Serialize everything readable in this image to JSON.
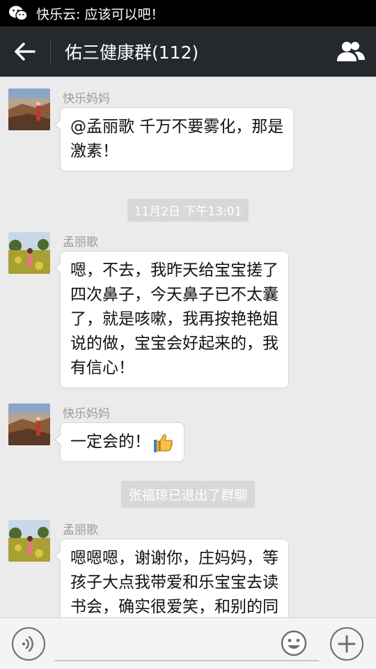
{
  "status_bar": {
    "notification_icon": "wechat-icon",
    "notification_text": "快乐云: 应该可以吧！"
  },
  "title_bar": {
    "back_icon": "arrow-left-icon",
    "title": "佑三健康群(112)",
    "members_icon": "group-members-icon"
  },
  "messages": [
    {
      "type": "msg",
      "sender": "快乐妈妈",
      "avatar": "canyon",
      "lines": [
        "@孟丽歌 千万不要雾化，那是",
        "激素！"
      ]
    },
    {
      "type": "system",
      "text": "11月2日 下午13:01"
    },
    {
      "type": "msg",
      "sender": "孟丽歌",
      "avatar": "field",
      "lines": [
        "嗯，不去，我昨天给宝宝搓了",
        "四次鼻子，今天鼻子已不太囊",
        "了，就是咳嗽，我再按艳艳姐",
        "说的做，宝宝会好起来的，我",
        "有信心！"
      ]
    },
    {
      "type": "msg",
      "sender": "快乐妈妈",
      "avatar": "canyon",
      "lines": [
        "一定会的！"
      ],
      "emoji": "thumbs-up-icon"
    },
    {
      "type": "system",
      "text": "张福琼已退出了群聊"
    },
    {
      "type": "msg",
      "sender": "孟丽歌",
      "avatar": "field",
      "lines": [
        "嗯嗯嗯，谢谢你，庄妈妈，等",
        "孩子大点我带爱和乐宝宝去读",
        "书会，确实很爱笑，和别的同"
      ]
    }
  ],
  "input_bar": {
    "voice_icon": "voice-icon",
    "text_value": "",
    "emoji_icon": "smiley-icon",
    "plus_icon": "plus-icon"
  },
  "colors": {
    "title_bar_bg": "#25282d",
    "status_bar_bg": "#000000",
    "chat_bg": "#ebebeb",
    "system_msg_bg": "#d8d8d8"
  }
}
